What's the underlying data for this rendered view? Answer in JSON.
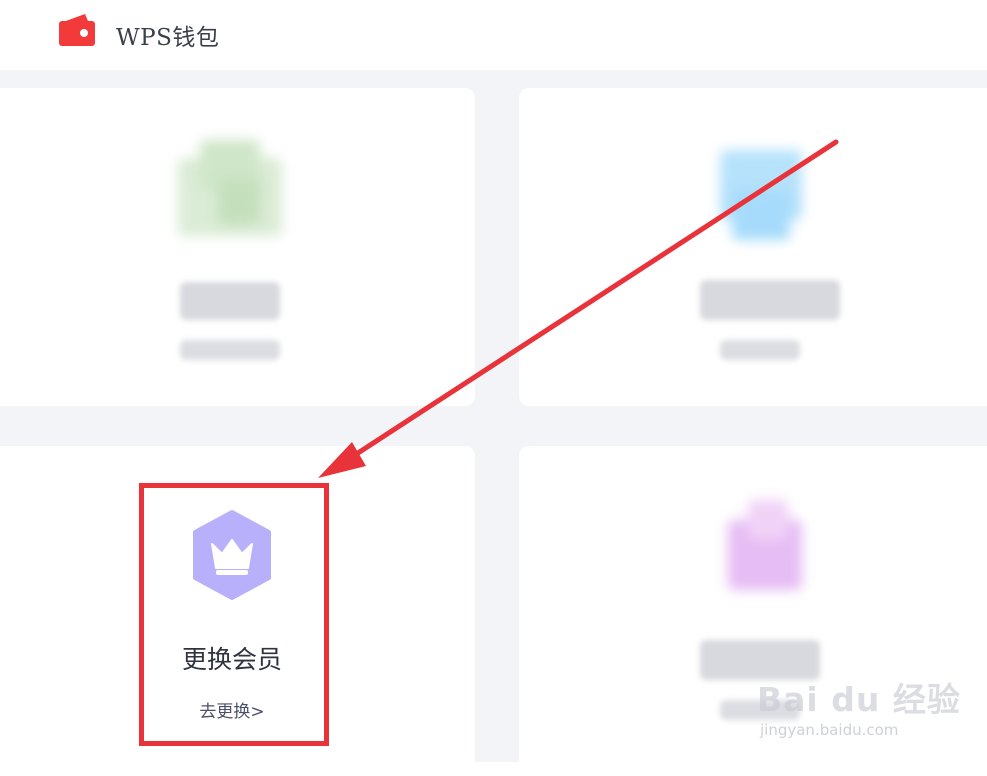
{
  "header": {
    "title": "WPS钱包",
    "logo_icon": "wallet-icon",
    "accent": "#f23a3a"
  },
  "cards": [
    {
      "id": "card-1",
      "icon": "green-blurred-icon",
      "blurred": true
    },
    {
      "id": "card-2",
      "icon": "blue-blurred-icon",
      "blurred": true
    },
    {
      "id": "card-3",
      "icon": "crown-icon",
      "icon_color": "#b9b0fb",
      "title": "更换会员",
      "link": "去更换>"
    },
    {
      "id": "card-4",
      "icon": "purple-blurred-icon",
      "blurred": true
    }
  ],
  "annotation": {
    "box_color": "#e8333a",
    "arrow_color": "#e8333a"
  },
  "watermark": {
    "main": "Bai du 经验",
    "sub": "jingyan.baidu.com"
  }
}
